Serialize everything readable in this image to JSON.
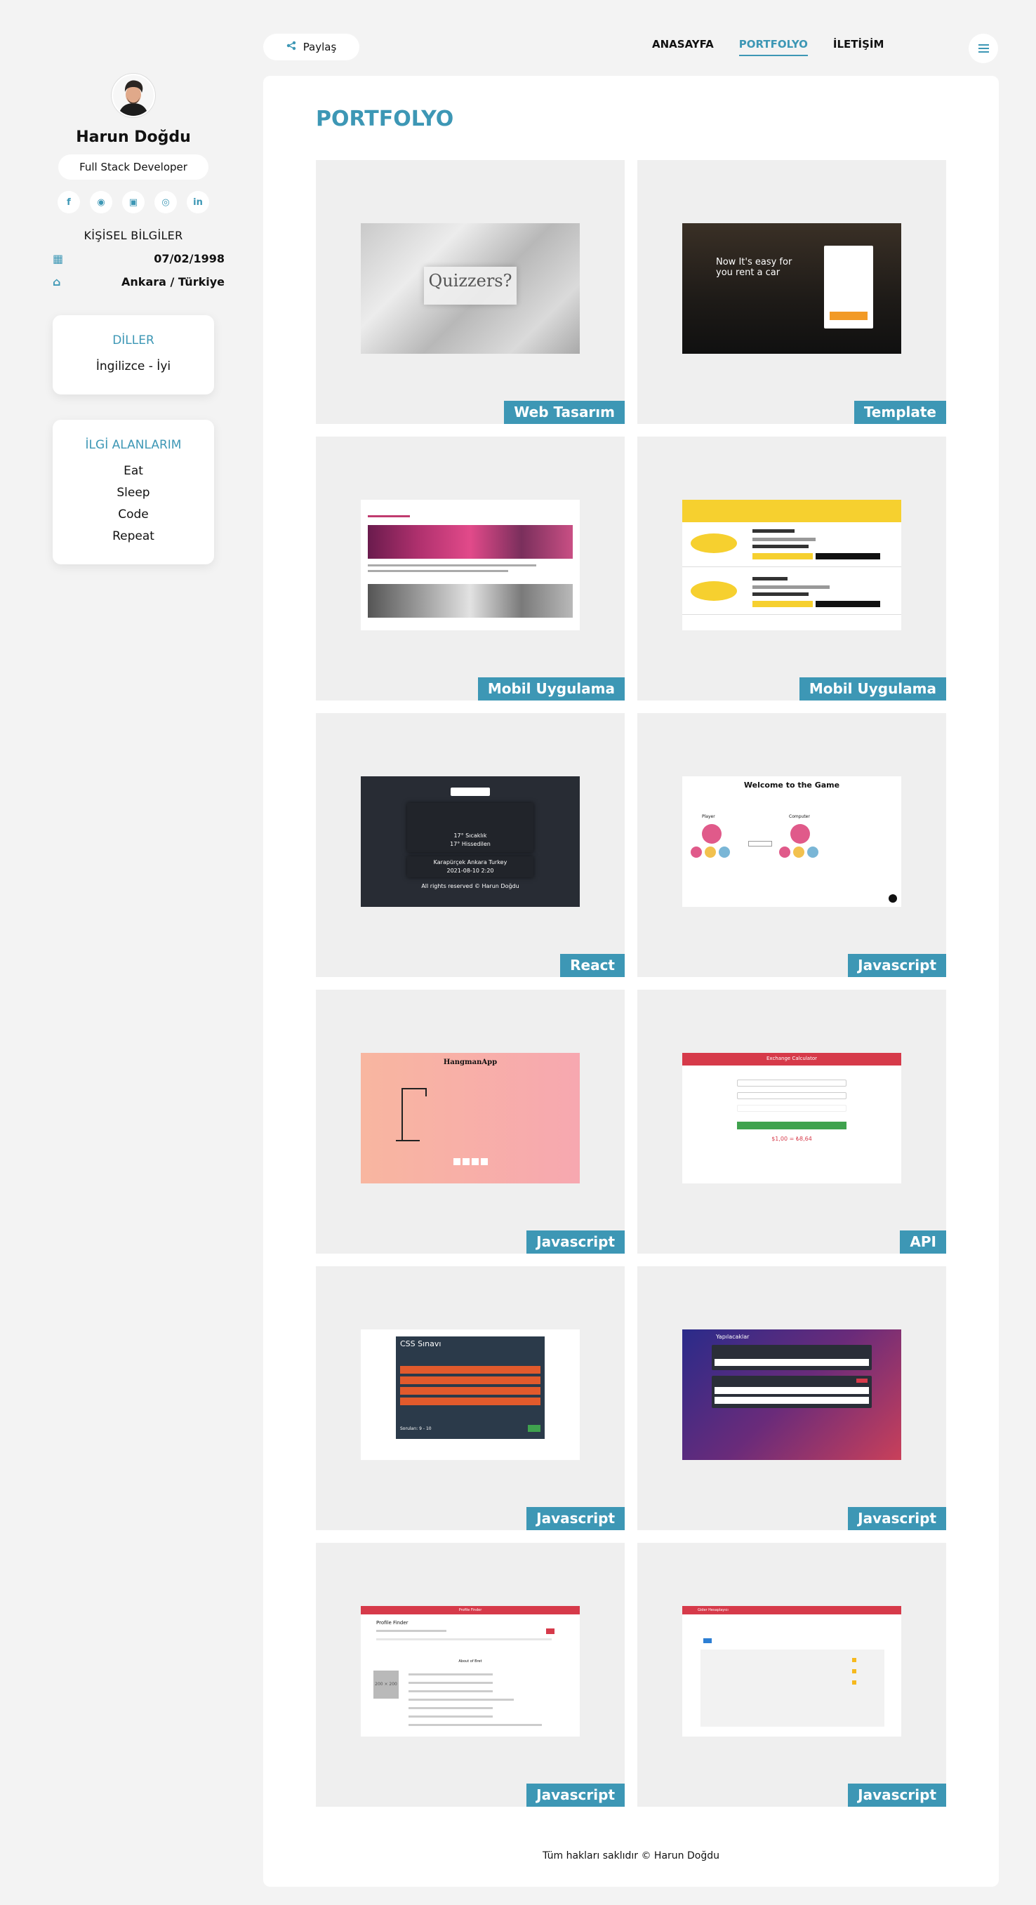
{
  "profile": {
    "name": "Harun Doğdu",
    "role": "Full Stack Developer",
    "socials": [
      {
        "icon": "facebook-icon",
        "glyph": "f"
      },
      {
        "icon": "github-icon",
        "glyph": "◉"
      },
      {
        "icon": "twitter-icon",
        "glyph": "▣"
      },
      {
        "icon": "instagram-icon",
        "glyph": "◎"
      },
      {
        "icon": "linkedin-icon",
        "glyph": "in"
      }
    ],
    "info_title": "KİŞİSEL BİLGİLER",
    "birthdate": "07/02/1998",
    "location": "Ankara / Türkiye"
  },
  "languages": {
    "title": "DİLLER",
    "items": [
      "İngilizce - İyi"
    ]
  },
  "interests": {
    "title": "İLGİ ALANLARIM",
    "items": [
      "Eat",
      "Sleep",
      "Code",
      "Repeat"
    ]
  },
  "topbar": {
    "share_label": "Paylaş",
    "nav": [
      {
        "label": "ANASAYFA",
        "active": false
      },
      {
        "label": "PORTFOLYO",
        "active": true
      },
      {
        "label": "İLETİŞİM",
        "active": false
      }
    ]
  },
  "portfolio": {
    "title": "PORTFOLYO",
    "items": [
      {
        "tag": "Web Tasarım",
        "kind": "quiz"
      },
      {
        "tag": "Template",
        "kind": "car"
      },
      {
        "tag": "Mobil Uygulama",
        "kind": "flow"
      },
      {
        "tag": "Mobil Uygulama",
        "kind": "taxi"
      },
      {
        "tag": "React",
        "kind": "weather"
      },
      {
        "tag": "Javascript",
        "kind": "game"
      },
      {
        "tag": "Javascript",
        "kind": "hang"
      },
      {
        "tag": "API",
        "kind": "exchange"
      },
      {
        "tag": "Javascript",
        "kind": "css"
      },
      {
        "tag": "Javascript",
        "kind": "todo"
      },
      {
        "tag": "Javascript",
        "kind": "profile"
      },
      {
        "tag": "Javascript",
        "kind": "budget"
      }
    ]
  },
  "shots": {
    "quiz_logo": "Quizzers?",
    "car_text": "Now It's easy for you rent a car",
    "weather_temp": "17° Sıcaklık",
    "weather_feel": "17° Hissedilen",
    "weather_loc": "Karapürçek Ankara Turkey",
    "weather_date": "2021-08-10 2:20",
    "weather_footer": "All rights reserved © Harun Doğdu",
    "game_title": "Welcome to the Game",
    "game_player": "Player",
    "game_computer": "Computer",
    "hang_title": "HangmanApp",
    "ex_title": "Exchange Calculator",
    "ex_result": "$1,00 = ₺8,64",
    "css_title": "CSS Sınavı",
    "css_score": "Soruları: 9 - 10",
    "todo_title": "Yapılacaklar",
    "pf_title": "Profile Finder",
    "pf_about": "About of Bret",
    "pf_img": "200 × 200",
    "budget_title": "Gider Hesaplayıcı"
  },
  "footer": {
    "text": "Tüm hakları saklıdır © Harun Doğdu"
  },
  "colors": {
    "accent": "#3d97b5",
    "background": "#f3f3f3"
  }
}
